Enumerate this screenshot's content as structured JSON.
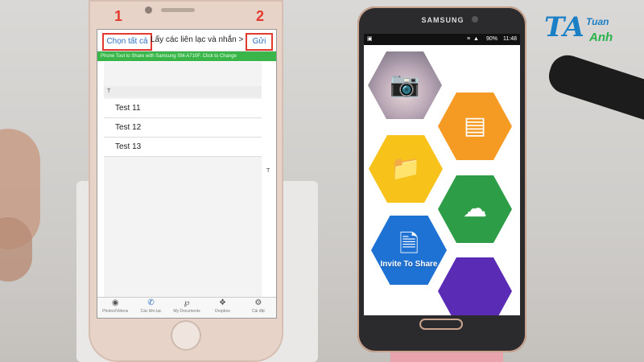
{
  "iphone_app": {
    "nav": {
      "select_all": "Chọn tất cả",
      "title": "Lấy các liên lạc và nhắn >",
      "send": "Gửi"
    },
    "annotations": {
      "one": "1",
      "two": "2"
    },
    "banner": "Phone Tool to Share with Samsung SM-A710F. Click to Change",
    "section_header": "T",
    "contacts": [
      "Test 11",
      "Test 12",
      "Test 13"
    ],
    "index_letter": "T",
    "tabs": [
      {
        "label": "Photos/Videos",
        "icon": "camera-icon"
      },
      {
        "label": "Các liên lạc",
        "icon": "phone-icon"
      },
      {
        "label": "My Documents",
        "icon": "paperclip-icon"
      },
      {
        "label": "Dropbox",
        "icon": "dropbox-icon"
      },
      {
        "label": "Cài đặt",
        "icon": "gear-icon"
      }
    ]
  },
  "samsung_app": {
    "brand": "SAMSUNG",
    "status": {
      "battery": "90%",
      "time": "11:48"
    },
    "hex_tiles": [
      {
        "name": "camera",
        "color": "#8d8894",
        "icon": "camera-icon"
      },
      {
        "name": "notes",
        "color": "#f59a23",
        "icon": "notebook-icon"
      },
      {
        "name": "folder",
        "color": "#f7c21a",
        "icon": "folder-icon"
      },
      {
        "name": "cloud",
        "color": "#2e9d47",
        "icon": "cloud-download-icon"
      },
      {
        "name": "invite",
        "color": "#1e72d4",
        "icon": "document-icon",
        "label": "Invite To Share"
      },
      {
        "name": "extra",
        "color": "#5a2bb4",
        "icon": ""
      }
    ]
  },
  "logo": {
    "mark": "TA",
    "top": "Tuan",
    "bottom": "Anh"
  }
}
